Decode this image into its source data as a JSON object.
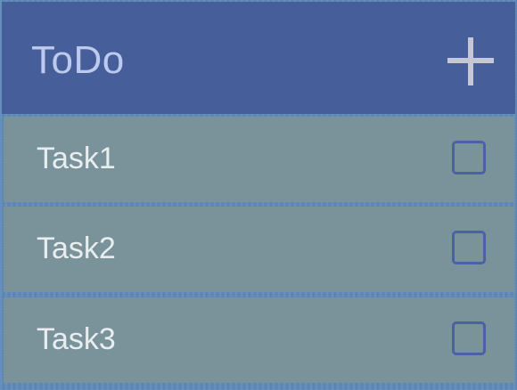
{
  "header": {
    "title": "ToDo",
    "add_icon": "plus-icon"
  },
  "tasks": [
    {
      "label": "Task1",
      "checked": false
    },
    {
      "label": "Task2",
      "checked": false
    },
    {
      "label": "Task3",
      "checked": false
    }
  ],
  "colors": {
    "header_bg": "#465e9a",
    "title_text": "#bccaee",
    "row_bg": "#7a939b",
    "row_text": "#e8edf0",
    "checkbox_border": "#4a61a6",
    "plus_icon": "#c5c8d4",
    "background": "#5b86b8"
  }
}
